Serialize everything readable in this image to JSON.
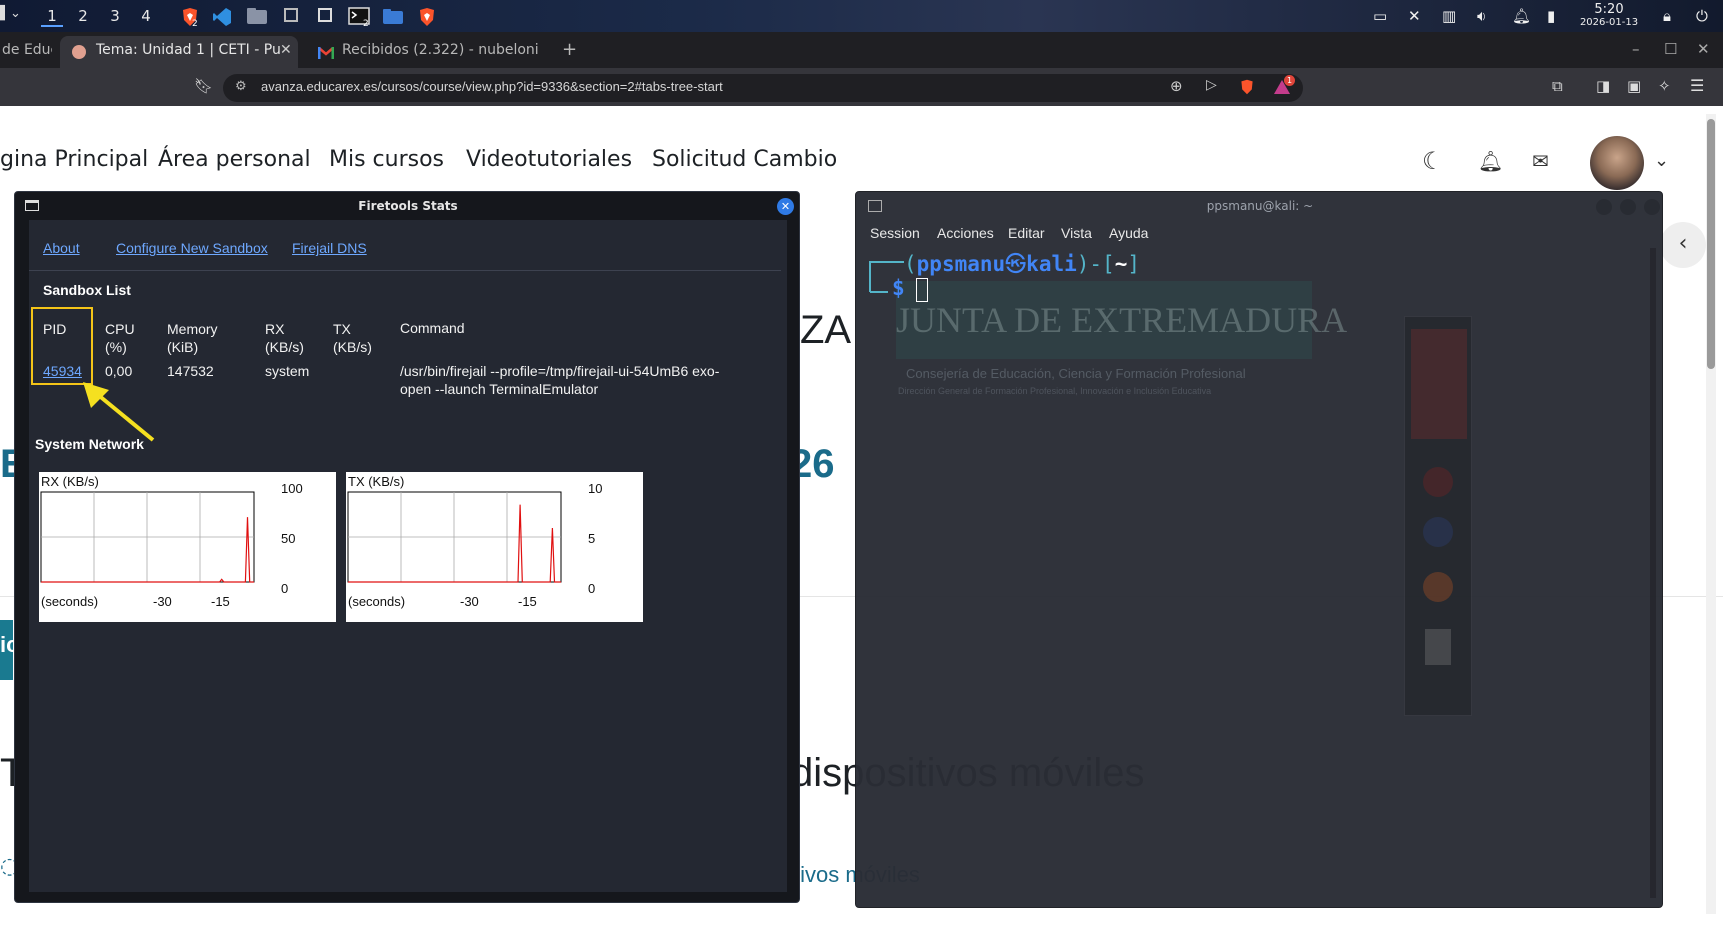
{
  "topbar": {
    "workspaces": [
      "1",
      "2",
      "3",
      "4"
    ],
    "clock_time": "5:20",
    "clock_date": "2026-01-13",
    "badge_2": "2"
  },
  "tabs": {
    "tab1": "de Educ",
    "tab2": "Tema: Unidad 1 | CETI - Pu",
    "tab3": "Recibidos (2.322) - nubelonia",
    "new_tab": "+"
  },
  "urlbar": {
    "url": "avanza.educarex.es/cursos/course/view.php?id=9336&section=2#tabs-tree-start",
    "brave_alert_count": "1"
  },
  "site_nav": {
    "items": [
      "gina Principal",
      "Área personal",
      "Mis cursos",
      "Videotutoriales",
      "Solicitud Cambio"
    ]
  },
  "page_bg": {
    "frag_za": "ZA",
    "frag_26": "26",
    "frag_e": "E",
    "frag_ic": "ic",
    "frag_t": "T",
    "heading_fragment": "dispositivos móviles",
    "link_fragment": "tivos móviles",
    "junta_title": "JUNTA DE EXTREMADURA",
    "junta_sub1": "Consejería de Educación, Ciencia y Formación Profesional",
    "junta_sub2": "Dirección General de Formación Profesional, Innovación e Inclusión Educativa"
  },
  "firetools": {
    "title": "Firetools Stats",
    "links": [
      "About",
      "Configure New Sandbox",
      "Firejail DNS"
    ],
    "sandbox_list_label": "Sandbox List",
    "columns": [
      "PID",
      "CPU\n(%)",
      "Memory\n(KiB)",
      "RX\n(KB/s)",
      "TX\n(KB/s)",
      "Command"
    ],
    "row": {
      "pid": "45934",
      "cpu": "0,00",
      "memory": "147532",
      "rx": "system",
      "tx": "",
      "command_line1": "/usr/bin/firejail --profile=/tmp/firejail-ui-54UmB6 exo-",
      "command_line2": "open --launch TerminalEmulator"
    },
    "system_network_label": "System Network",
    "rx_graph": {
      "label": "RX (KB/s)",
      "y_ticks": [
        "100",
        "50",
        "0"
      ],
      "x_ticks": [
        "(seconds)",
        "-30",
        "-15"
      ],
      "ymax": 100,
      "series": [
        0,
        0,
        0,
        0,
        0,
        0,
        0,
        0,
        0,
        0,
        0,
        0,
        0,
        0,
        0,
        0,
        0,
        0,
        0,
        0,
        0,
        0,
        0,
        0,
        0,
        0,
        0,
        0,
        0,
        0,
        0,
        0,
        0,
        0,
        0,
        0,
        0,
        0,
        0,
        0,
        0,
        0,
        0,
        0,
        0,
        0,
        0,
        0,
        0,
        0,
        0,
        0,
        0,
        0,
        0,
        0,
        0,
        0,
        0,
        0,
        0,
        0,
        0,
        0,
        0,
        0,
        0,
        0,
        0,
        0,
        0,
        0,
        0,
        0,
        0,
        0,
        0,
        0,
        0,
        0,
        0,
        0,
        0,
        0,
        3,
        0,
        0,
        0,
        0,
        0,
        0,
        0,
        0,
        0,
        0,
        0,
        72,
        0,
        0,
        0
      ]
    },
    "tx_graph": {
      "label": "TX (KB/s)",
      "y_ticks": [
        "10",
        "5",
        "0"
      ],
      "x_ticks": [
        "(seconds)",
        "-30",
        "-15"
      ],
      "ymax": 10,
      "series": [
        0,
        0,
        0,
        0,
        0,
        0,
        0,
        0,
        0,
        0,
        0,
        0,
        0,
        0,
        0,
        0,
        0,
        0,
        0,
        0,
        0,
        0,
        0,
        0,
        0,
        0,
        0,
        0,
        0,
        0,
        0,
        0,
        0,
        0,
        0,
        0,
        0,
        0,
        0,
        0,
        0,
        0,
        0,
        0,
        0,
        0,
        0,
        0,
        0,
        0,
        0,
        0,
        0,
        0,
        0,
        0,
        0,
        0,
        0,
        0,
        0,
        0,
        0,
        0,
        0,
        0,
        0,
        0,
        0,
        0,
        0,
        0,
        0,
        0,
        0,
        0,
        0,
        0,
        0,
        0,
        8.6,
        0,
        0,
        0,
        0,
        0,
        0,
        0,
        0,
        0,
        0,
        0,
        0,
        0,
        0,
        6.0,
        0,
        0,
        0,
        0
      ]
    }
  },
  "terminal": {
    "title": "ppsmanu@kali: ~",
    "menus": [
      "Session",
      "Acciones",
      "Editar",
      "Vista",
      "Ayuda"
    ],
    "prompt_user": "ppsmanu",
    "prompt_sep": "㉿",
    "prompt_host": "kali",
    "prompt_dir": "~",
    "prompt_symbol": "$"
  },
  "colors": {
    "highlight_box": "#f5c518",
    "arrow": "#f5e020",
    "graph_line": "#e01010",
    "link": "#6ea8ff",
    "prompt_blue": "#3b82f6",
    "prompt_cyan": "#4fb3c8"
  }
}
